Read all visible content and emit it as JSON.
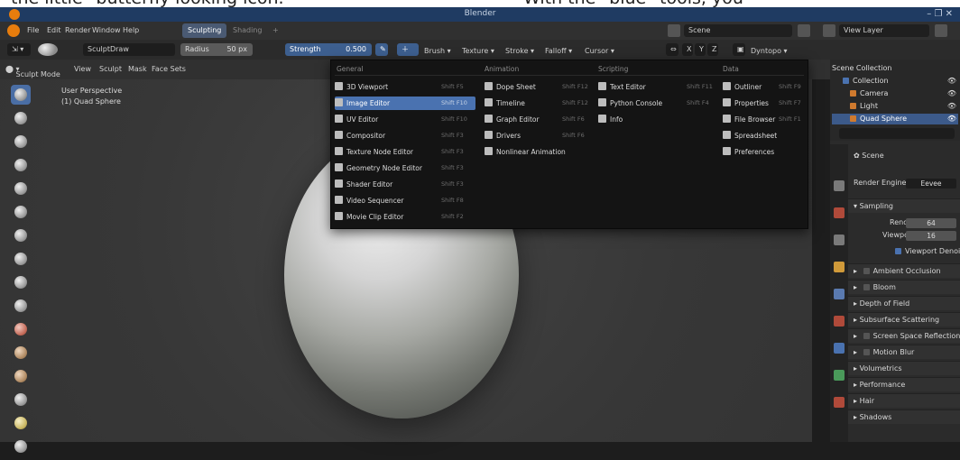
{
  "caption": {
    "left_text": "the little \"butterfly looking icon.\"",
    "right_text": "With the \"blue\" tools, you"
  },
  "window": {
    "title": "Blender",
    "controls": "– ❐ ✕"
  },
  "menubar": {
    "items": [
      "File",
      "Edit",
      "Render",
      "Window",
      "Help"
    ],
    "workspaces": [
      {
        "label": "Sculpting",
        "active": true
      },
      {
        "label": "Shading",
        "active": false
      },
      {
        "label": "+",
        "active": false
      }
    ],
    "scene": "Scene",
    "view_layer": "View Layer"
  },
  "toolbar": {
    "brush_name": "SculptDraw",
    "radius_label": "Radius",
    "radius_value": "50 px",
    "strength_label": "Strength",
    "strength_value": "0.500",
    "menus": [
      "Brush",
      "Texture",
      "Stroke",
      "Falloff",
      "Cursor"
    ],
    "axes": [
      "X",
      "Y",
      "Z"
    ],
    "dyntopo": "Dyntopo"
  },
  "header3d": {
    "mode": "Sculpt Mode",
    "menus": [
      "View",
      "Sculpt",
      "Mask",
      "Face Sets"
    ]
  },
  "viewport": {
    "perspective": "User Perspective",
    "object": "(1) Quad Sphere"
  },
  "editor_menu": {
    "sections": [
      {
        "title": "General",
        "items": [
          {
            "label": "3D Viewport",
            "shortcut": "Shift F5",
            "icon": "3d-viewport-icon"
          },
          {
            "label": "Image Editor",
            "shortcut": "Shift F10",
            "icon": "image-editor-icon",
            "highlight": true
          },
          {
            "label": "UV Editor",
            "shortcut": "Shift F10",
            "icon": "uv-editor-icon"
          },
          {
            "label": "Compositor",
            "shortcut": "Shift F3",
            "icon": "compositor-icon"
          },
          {
            "label": "Texture Node Editor",
            "shortcut": "Shift F3",
            "icon": "texture-node-icon"
          },
          {
            "label": "Geometry Node Editor",
            "shortcut": "Shift F3",
            "icon": "geometry-node-icon"
          },
          {
            "label": "Shader Editor",
            "shortcut": "Shift F3",
            "icon": "shader-editor-icon"
          },
          {
            "label": "Video Sequencer",
            "shortcut": "Shift F8",
            "icon": "video-sequencer-icon"
          },
          {
            "label": "Movie Clip Editor",
            "shortcut": "Shift F2",
            "icon": "movie-clip-icon"
          }
        ]
      },
      {
        "title": "Animation",
        "items": [
          {
            "label": "Dope Sheet",
            "shortcut": "Shift F12",
            "icon": "dope-sheet-icon"
          },
          {
            "label": "Timeline",
            "shortcut": "Shift F12",
            "icon": "timeline-icon"
          },
          {
            "label": "Graph Editor",
            "shortcut": "Shift F6",
            "icon": "graph-editor-icon"
          },
          {
            "label": "Drivers",
            "shortcut": "Shift F6",
            "icon": "drivers-icon"
          },
          {
            "label": "Nonlinear Animation",
            "shortcut": "",
            "icon": "nla-icon"
          }
        ]
      },
      {
        "title": "Scripting",
        "items": [
          {
            "label": "Text Editor",
            "shortcut": "Shift F11",
            "icon": "text-editor-icon"
          },
          {
            "label": "Python Console",
            "shortcut": "Shift F4",
            "icon": "python-console-icon"
          },
          {
            "label": "Info",
            "shortcut": "",
            "icon": "info-icon"
          }
        ]
      },
      {
        "title": "Data",
        "items": [
          {
            "label": "Outliner",
            "shortcut": "Shift F9",
            "icon": "outliner-icon"
          },
          {
            "label": "Properties",
            "shortcut": "Shift F7",
            "icon": "properties-icon"
          },
          {
            "label": "File Browser",
            "shortcut": "Shift F1",
            "icon": "file-browser-icon"
          },
          {
            "label": "Spreadsheet",
            "shortcut": "",
            "icon": "spreadsheet-icon"
          },
          {
            "label": "Preferences",
            "shortcut": "",
            "icon": "preferences-icon"
          }
        ]
      }
    ]
  },
  "outliner": {
    "root": "Scene Collection",
    "rows": [
      {
        "label": "Collection",
        "indent": 1,
        "selected": false
      },
      {
        "label": "Camera",
        "indent": 2,
        "selected": false
      },
      {
        "label": "Light",
        "indent": 2,
        "selected": false
      },
      {
        "label": "Quad Sphere",
        "indent": 2,
        "selected": true
      }
    ]
  },
  "properties": {
    "scene": "Scene",
    "render_engine_label": "Render Engine",
    "render_engine": "Eevee",
    "sampling": "Sampling",
    "render_label": "Render",
    "render_value": "64",
    "viewport_label": "Viewport",
    "viewport_value": "16",
    "viewport_denoise": "Viewport Denoi...",
    "sections": [
      {
        "label": "Ambient Occlusion",
        "checkbox": true
      },
      {
        "label": "Bloom",
        "checkbox": true
      },
      {
        "label": "Depth of Field",
        "checkbox": false
      },
      {
        "label": "Subsurface Scattering",
        "checkbox": false
      },
      {
        "label": "Screen Space Reflections",
        "checkbox": true
      },
      {
        "label": "Motion Blur",
        "checkbox": true
      },
      {
        "label": "Volumetrics",
        "checkbox": false
      },
      {
        "label": "Performance",
        "checkbox": false
      },
      {
        "label": "Hair",
        "checkbox": false
      },
      {
        "label": "Shadows",
        "checkbox": false
      }
    ]
  },
  "colors": {
    "accent": "#4a72b0",
    "title_bar": "#1f3b62",
    "menu_bg": "#141414"
  }
}
